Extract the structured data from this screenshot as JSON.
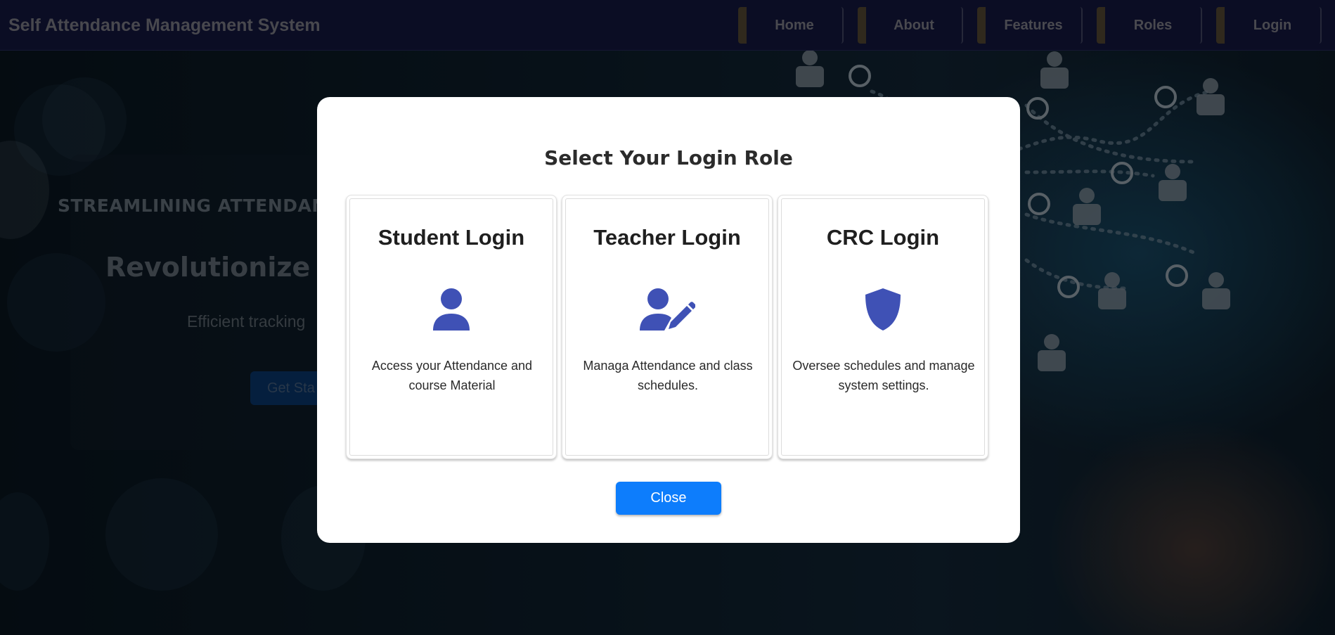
{
  "navbar": {
    "brand": "Self Attendance Management System",
    "items": [
      {
        "label": "Home"
      },
      {
        "label": "About"
      },
      {
        "label": "Features"
      },
      {
        "label": "Roles"
      },
      {
        "label": "Login"
      }
    ]
  },
  "hero": {
    "tagline": "STREAMLINING ATTENDANC",
    "title": "Revolutionize At",
    "subtitle": "Efficient tracking",
    "cta_label": "Get Sta"
  },
  "modal": {
    "title": "Select Your Login Role",
    "cards": [
      {
        "title": "Student Login",
        "icon": "user-icon",
        "description": "Access your Attendance and course Material"
      },
      {
        "title": "Teacher Login",
        "icon": "user-pen-icon",
        "description": "Managa Attendance and class schedules."
      },
      {
        "title": "CRC Login",
        "icon": "shield-icon",
        "description": "Oversee schedules and manage system settings."
      }
    ],
    "close_label": "Close"
  },
  "colors": {
    "navbar_bg": "#161a45",
    "icon_blue": "#3f51b5",
    "close_button": "#0d7dfc",
    "modal_bg": "#ffffff"
  }
}
